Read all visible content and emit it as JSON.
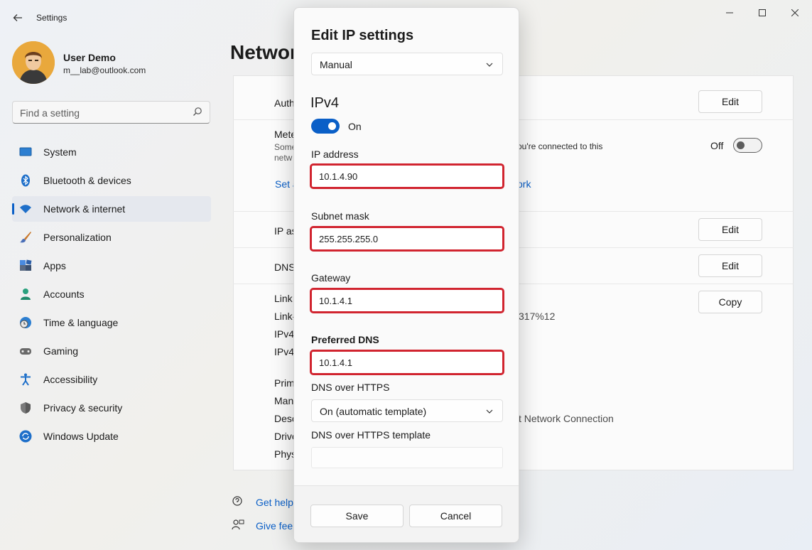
{
  "window": {
    "title": "Settings"
  },
  "user": {
    "name": "User Demo",
    "email": "m__lab@outlook.com"
  },
  "search": {
    "placeholder": "Find a setting"
  },
  "nav": {
    "items": [
      {
        "label": "System",
        "icon": "monitor-icon",
        "active": false
      },
      {
        "label": "Bluetooth & devices",
        "icon": "bluetooth-icon",
        "active": false
      },
      {
        "label": "Network & internet",
        "icon": "wifi-icon",
        "active": true
      },
      {
        "label": "Personalization",
        "icon": "brush-icon",
        "active": false
      },
      {
        "label": "Apps",
        "icon": "apps-icon",
        "active": false
      },
      {
        "label": "Accounts",
        "icon": "person-icon",
        "active": false
      },
      {
        "label": "Time & language",
        "icon": "globe-clock-icon",
        "active": false
      },
      {
        "label": "Gaming",
        "icon": "gamepad-icon",
        "active": false
      },
      {
        "label": "Accessibility",
        "icon": "accessibility-icon",
        "active": false
      },
      {
        "label": "Privacy & security",
        "icon": "shield-icon",
        "active": false
      },
      {
        "label": "Windows Update",
        "icon": "update-icon",
        "active": false
      }
    ]
  },
  "page": {
    "title_partial": "Networ",
    "rows": {
      "auth": "Auth",
      "metered": "Mete",
      "metered_desc_1": "Some",
      "metered_desc_2": "netw",
      "metered_desc_right": "ou're connected to this",
      "metered_link_left": "Set a",
      "metered_link_right": "ork",
      "metered_toggle": "Off",
      "ip_assign": "IP as",
      "dns": "DNS",
      "link1": "Link",
      "link2": "Link-",
      "link2_value": "317%12",
      "ipv4_1": "IPv4",
      "ipv4_2": "IPv4",
      "prim": "Prim",
      "man": "Man",
      "desc": "Desc",
      "desc_value": "t Network Connection",
      "driv": "Drive",
      "phys": "Phys"
    },
    "buttons": {
      "edit": "Edit",
      "copy": "Copy"
    },
    "help": {
      "get_help": "Get help",
      "give_feedback": "Give fee"
    }
  },
  "dialog": {
    "title": "Edit IP settings",
    "mode": "Manual",
    "section": "IPv4",
    "toggle_label": "On",
    "fields": {
      "ip_label": "IP address",
      "ip_value": "10.1.4.90",
      "subnet_label": "Subnet mask",
      "subnet_value": "255.255.255.0",
      "gateway_label": "Gateway",
      "gateway_value": "10.1.4.1",
      "dns_label": "Preferred DNS",
      "dns_value": "10.1.4.1",
      "doh_label": "DNS over HTTPS",
      "doh_value": "On (automatic template)",
      "doh_template_label": "DNS over HTTPS template"
    },
    "save": "Save",
    "cancel": "Cancel"
  },
  "colors": {
    "accent": "#0a5fc7",
    "highlight": "#d1242f"
  }
}
